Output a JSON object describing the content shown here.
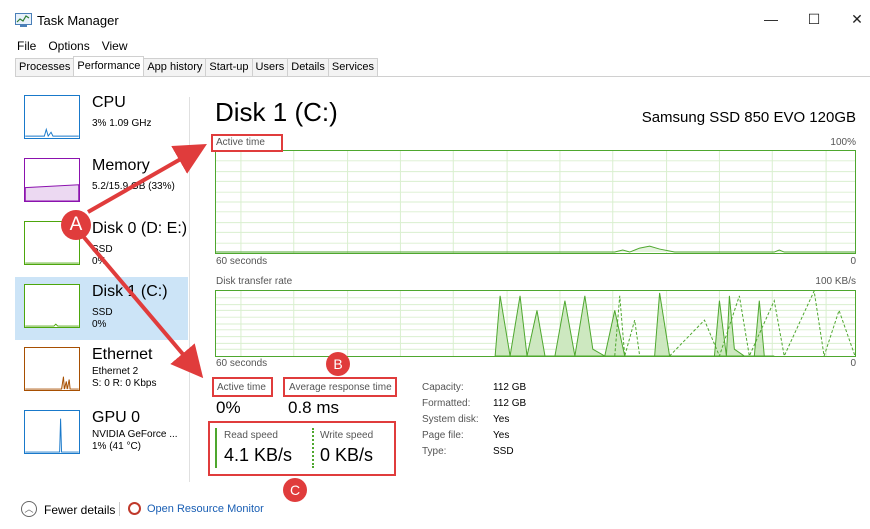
{
  "window": {
    "title": "Task Manager",
    "minimize_glyph": "—",
    "maximize_glyph": "☐",
    "close_glyph": "✕"
  },
  "menu": [
    "File",
    "Options",
    "View"
  ],
  "tabs": [
    {
      "label": "Processes",
      "active": false
    },
    {
      "label": "Performance",
      "active": true
    },
    {
      "label": "App history",
      "active": false
    },
    {
      "label": "Start-up",
      "active": false
    },
    {
      "label": "Users",
      "active": false
    },
    {
      "label": "Details",
      "active": false
    },
    {
      "label": "Services",
      "active": false
    }
  ],
  "sidebar": {
    "items": [
      {
        "title": "CPU",
        "sub1": "3%  1.09 GHz",
        "sub2": "",
        "sub3": "",
        "color": "#1979ca"
      },
      {
        "title": "Memory",
        "sub1": "5.2/15.9 GB (33%)",
        "sub2": "",
        "sub3": "",
        "color": "#8b12ae"
      },
      {
        "title": "Disk 0 (D: E:)",
        "sub1": "SSD",
        "sub2": "0%",
        "sub3": "",
        "color": "#4da60c"
      },
      {
        "title": "Disk 1 (C:)",
        "sub1": "SSD",
        "sub2": "0%",
        "sub3": "",
        "color": "#4da60c"
      },
      {
        "title": "Ethernet",
        "sub1": "Ethernet 2",
        "sub2": "S: 0  R: 0 Kbps",
        "sub3": "",
        "color": "#a74f01"
      },
      {
        "title": "GPU 0",
        "sub1": "NVIDIA GeForce ...",
        "sub2": "1%  (41 °C)",
        "sub3": "",
        "color": "#1979ca"
      }
    ]
  },
  "main": {
    "title": "Disk 1 (C:)",
    "model": "Samsung SSD 850 EVO 120GB",
    "active_time_label": "Active time",
    "active_time_max": "100%",
    "time_span": "60 seconds",
    "zero": "0",
    "transfer_label": "Disk transfer rate",
    "transfer_max": "100 KB/s",
    "stats": {
      "active_time_label": "Active time",
      "active_time_value": "0%",
      "avg_response_label": "Average response time",
      "avg_response_value": "0.8 ms",
      "read_speed_label": "Read speed",
      "read_speed_value": "4.1 KB/s",
      "write_speed_label": "Write speed",
      "write_speed_value": "0 KB/s"
    },
    "info": [
      {
        "key": "Capacity:",
        "value": "112 GB"
      },
      {
        "key": "Formatted:",
        "value": "112 GB"
      },
      {
        "key": "System disk:",
        "value": "Yes"
      },
      {
        "key": "Page file:",
        "value": "Yes"
      },
      {
        "key": "Type:",
        "value": "SSD"
      }
    ]
  },
  "annotations": {
    "a": "A",
    "b": "B",
    "c": "C"
  },
  "footer": {
    "fewer_details": "Fewer details",
    "resource_monitor": "Open Resource Monitor"
  },
  "colors": {
    "accent_green": "#4ea72e",
    "annotation_red": "#e03c3c",
    "selected_bg": "#cce4f7"
  }
}
